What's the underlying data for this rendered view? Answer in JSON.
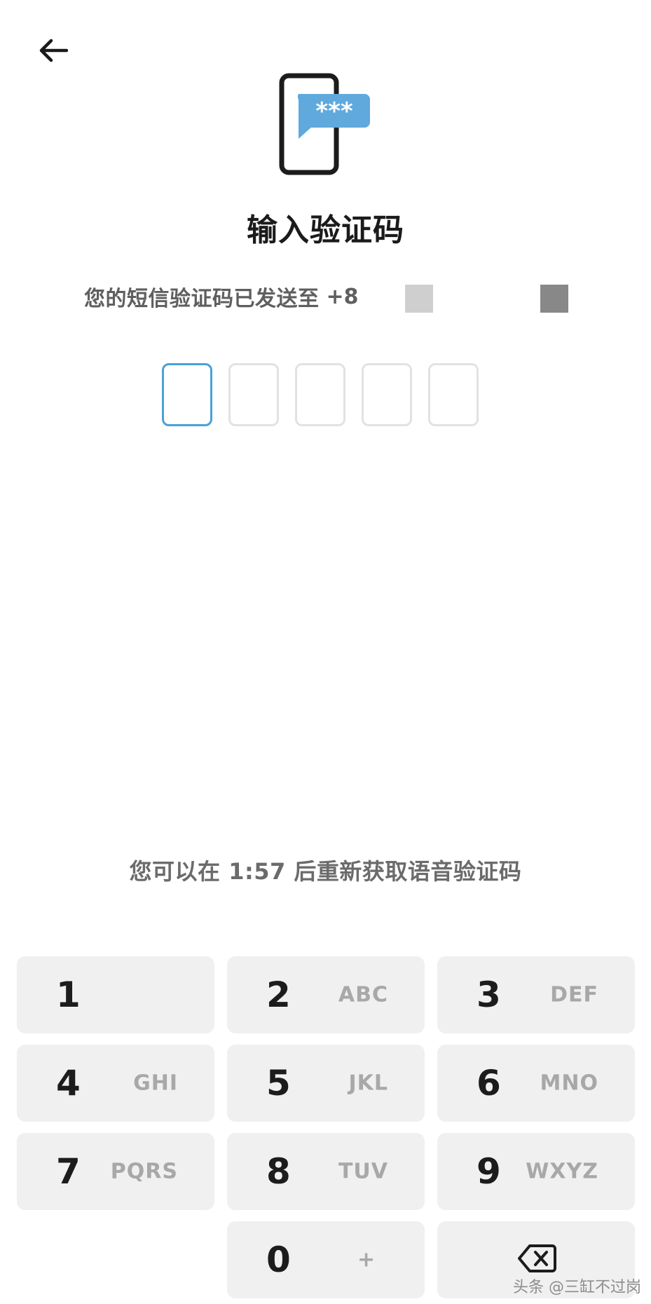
{
  "title": "输入验证码",
  "subtitle": "您的短信验证码已发送至",
  "phone_visible": "+8",
  "code_length": 5,
  "resend_text": "您可以在 1:57 后重新获取语音验证码",
  "keypad": {
    "keys": [
      {
        "digit": "1",
        "letters": ""
      },
      {
        "digit": "2",
        "letters": "ABC"
      },
      {
        "digit": "3",
        "letters": "DEF"
      },
      {
        "digit": "4",
        "letters": "GHI"
      },
      {
        "digit": "5",
        "letters": "JKL"
      },
      {
        "digit": "6",
        "letters": "MNO"
      },
      {
        "digit": "7",
        "letters": "PQRS"
      },
      {
        "digit": "8",
        "letters": "TUV"
      },
      {
        "digit": "9",
        "letters": "WXYZ"
      },
      {
        "digit": "0",
        "letters": "+"
      }
    ]
  },
  "watermark": "头条 @三缸不过岗",
  "colors": {
    "accent": "#4aa1d6",
    "message_bubble": "#5fa9dd",
    "key_bg": "#f0f0f0",
    "box_border": "#e2e2e2"
  },
  "icons": {
    "back": "arrow-left-icon",
    "hero": "phone-sms-icon",
    "delete": "backspace-icon"
  }
}
